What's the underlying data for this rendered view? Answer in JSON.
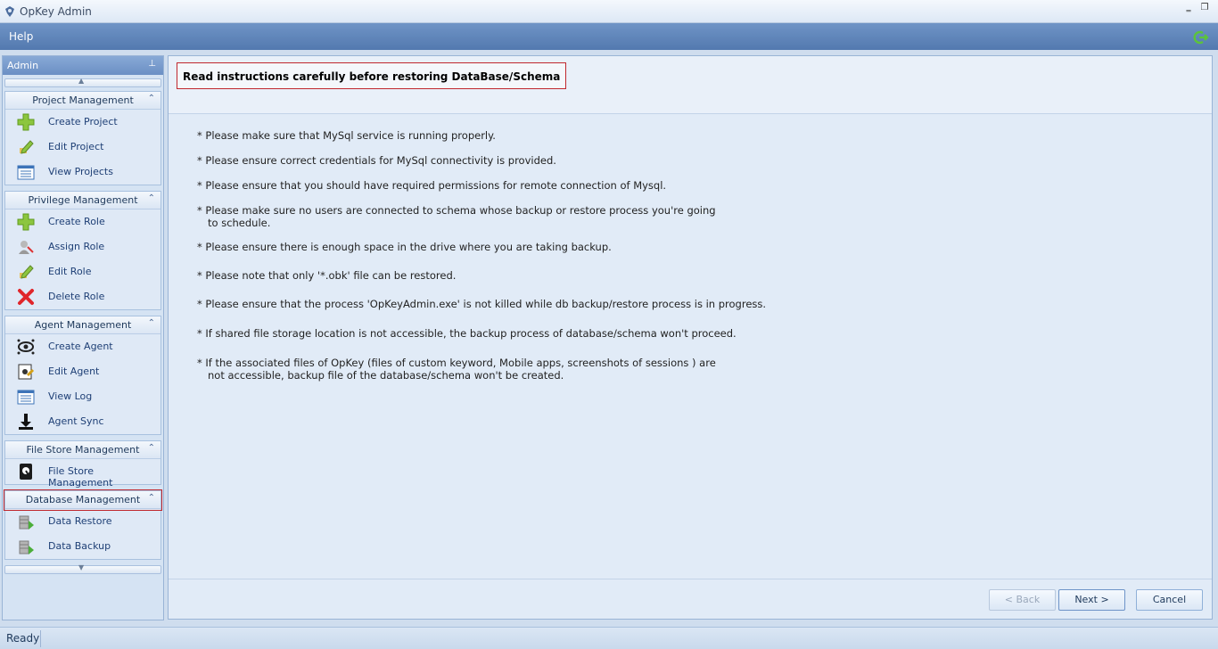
{
  "window": {
    "title": "OpKey Admin",
    "minimize": "‗",
    "restore": "❐"
  },
  "menu": {
    "help": "Help"
  },
  "sidebar": {
    "title": "Admin",
    "pin": "⊥",
    "groups": [
      {
        "title": "Project Management",
        "items": [
          {
            "label": "Create Project",
            "icon": "plus-icon"
          },
          {
            "label": "Edit Project",
            "icon": "edit-icon"
          },
          {
            "label": "View Projects",
            "icon": "list-icon"
          }
        ]
      },
      {
        "title": "Privilege Management",
        "items": [
          {
            "label": "Create Role",
            "icon": "plus-icon"
          },
          {
            "label": "Assign Role",
            "icon": "assign-icon"
          },
          {
            "label": "Edit Role",
            "icon": "edit-icon"
          },
          {
            "label": "Delete Role",
            "icon": "delete-icon"
          }
        ]
      },
      {
        "title": "Agent Management",
        "items": [
          {
            "label": "Create Agent",
            "icon": "agent-icon"
          },
          {
            "label": "Edit Agent",
            "icon": "edit-agent-icon"
          },
          {
            "label": "View Log",
            "icon": "list-icon"
          },
          {
            "label": "Agent Sync",
            "icon": "sync-icon"
          }
        ]
      },
      {
        "title": "File Store Management",
        "items": [
          {
            "label": "File Store Management",
            "icon": "file-store-icon"
          }
        ]
      },
      {
        "title": "Database Management",
        "items": [
          {
            "label": "Data Restore",
            "icon": "database-icon"
          },
          {
            "label": "Data Backup",
            "icon": "database-icon"
          }
        ]
      }
    ]
  },
  "main": {
    "notice": "Read instructions carefully before restoring DataBase/Schema",
    "instructions": [
      "* Please make sure that MySql service is running properly.",
      "* Please ensure correct credentials for MySql connectivity is provided.",
      "* Please ensure that you should have required permissions for remote connection of Mysql.",
      "* Please make sure no users are connected to schema whose backup or restore process you're going",
      "to schedule.",
      "* Please ensure there is enough space in the drive where you are taking backup.",
      "* Please note that only '*.obk' file can be restored.",
      "* Please ensure that the process 'OpKeyAdmin.exe' is not killed while db backup/restore process is in progress.",
      "* If shared file storage location is not accessible, the backup process of database/schema won't proceed.",
      "* If the associated files of OpKey (files of custom keyword, Mobile apps, screenshots of sessions ) are",
      "not accessible, backup file of the database/schema won't be created."
    ],
    "buttons": {
      "back": "< Back",
      "next": "Next >",
      "cancel": "Cancel"
    }
  },
  "status": {
    "text": "Ready"
  },
  "colors": {
    "accent": "#5379af",
    "highlight": "#c0272d"
  }
}
